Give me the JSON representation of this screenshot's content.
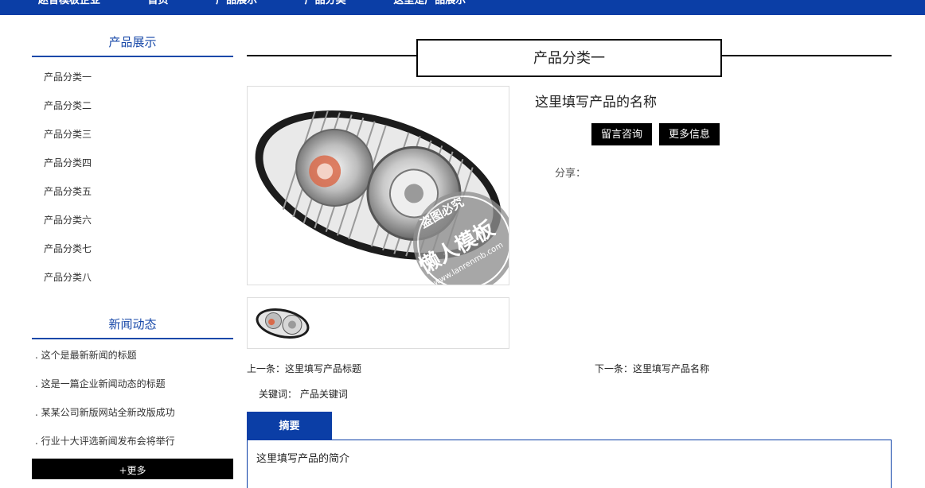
{
  "topnav": {
    "logo": "赵普模板企业",
    "items": [
      "首页",
      "产品展示",
      "产品分类",
      "这里是产品展示"
    ]
  },
  "sidebar": {
    "products_title": "产品展示",
    "products": [
      "产品分类一",
      "产品分类二",
      "产品分类三",
      "产品分类四",
      "产品分类五",
      "产品分类六",
      "产品分类七",
      "产品分类八"
    ],
    "news_title": "新闻动态",
    "news": [
      ". 这个是最新新闻的标题",
      ". 这是一篇企业新闻动态的标题",
      ". 某某公司新版网站全新改版成功",
      ". 行业十大评选新闻发布会将举行"
    ],
    "more_label": "+更多"
  },
  "main": {
    "category_title": "产品分类一",
    "product_name": "这里填写产品的名称",
    "consult_label": "留言咨询",
    "more_info_label": "更多信息",
    "share_label": "分享：",
    "prev_label": "上一条：这里填写产品标题",
    "next_label": "下一条：这里填写产品名称",
    "keywords_label": "关键词：",
    "keywords_value": "产品关键词",
    "tab_summary_label": "摘要",
    "summary_text": "这里填写产品的简介",
    "watermark_top": "盗图必究",
    "watermark_main": "懒人模板",
    "watermark_url": "www.lanrenmb.com"
  },
  "colors": {
    "brand_blue": "#0b3ea6",
    "black": "#000000"
  }
}
